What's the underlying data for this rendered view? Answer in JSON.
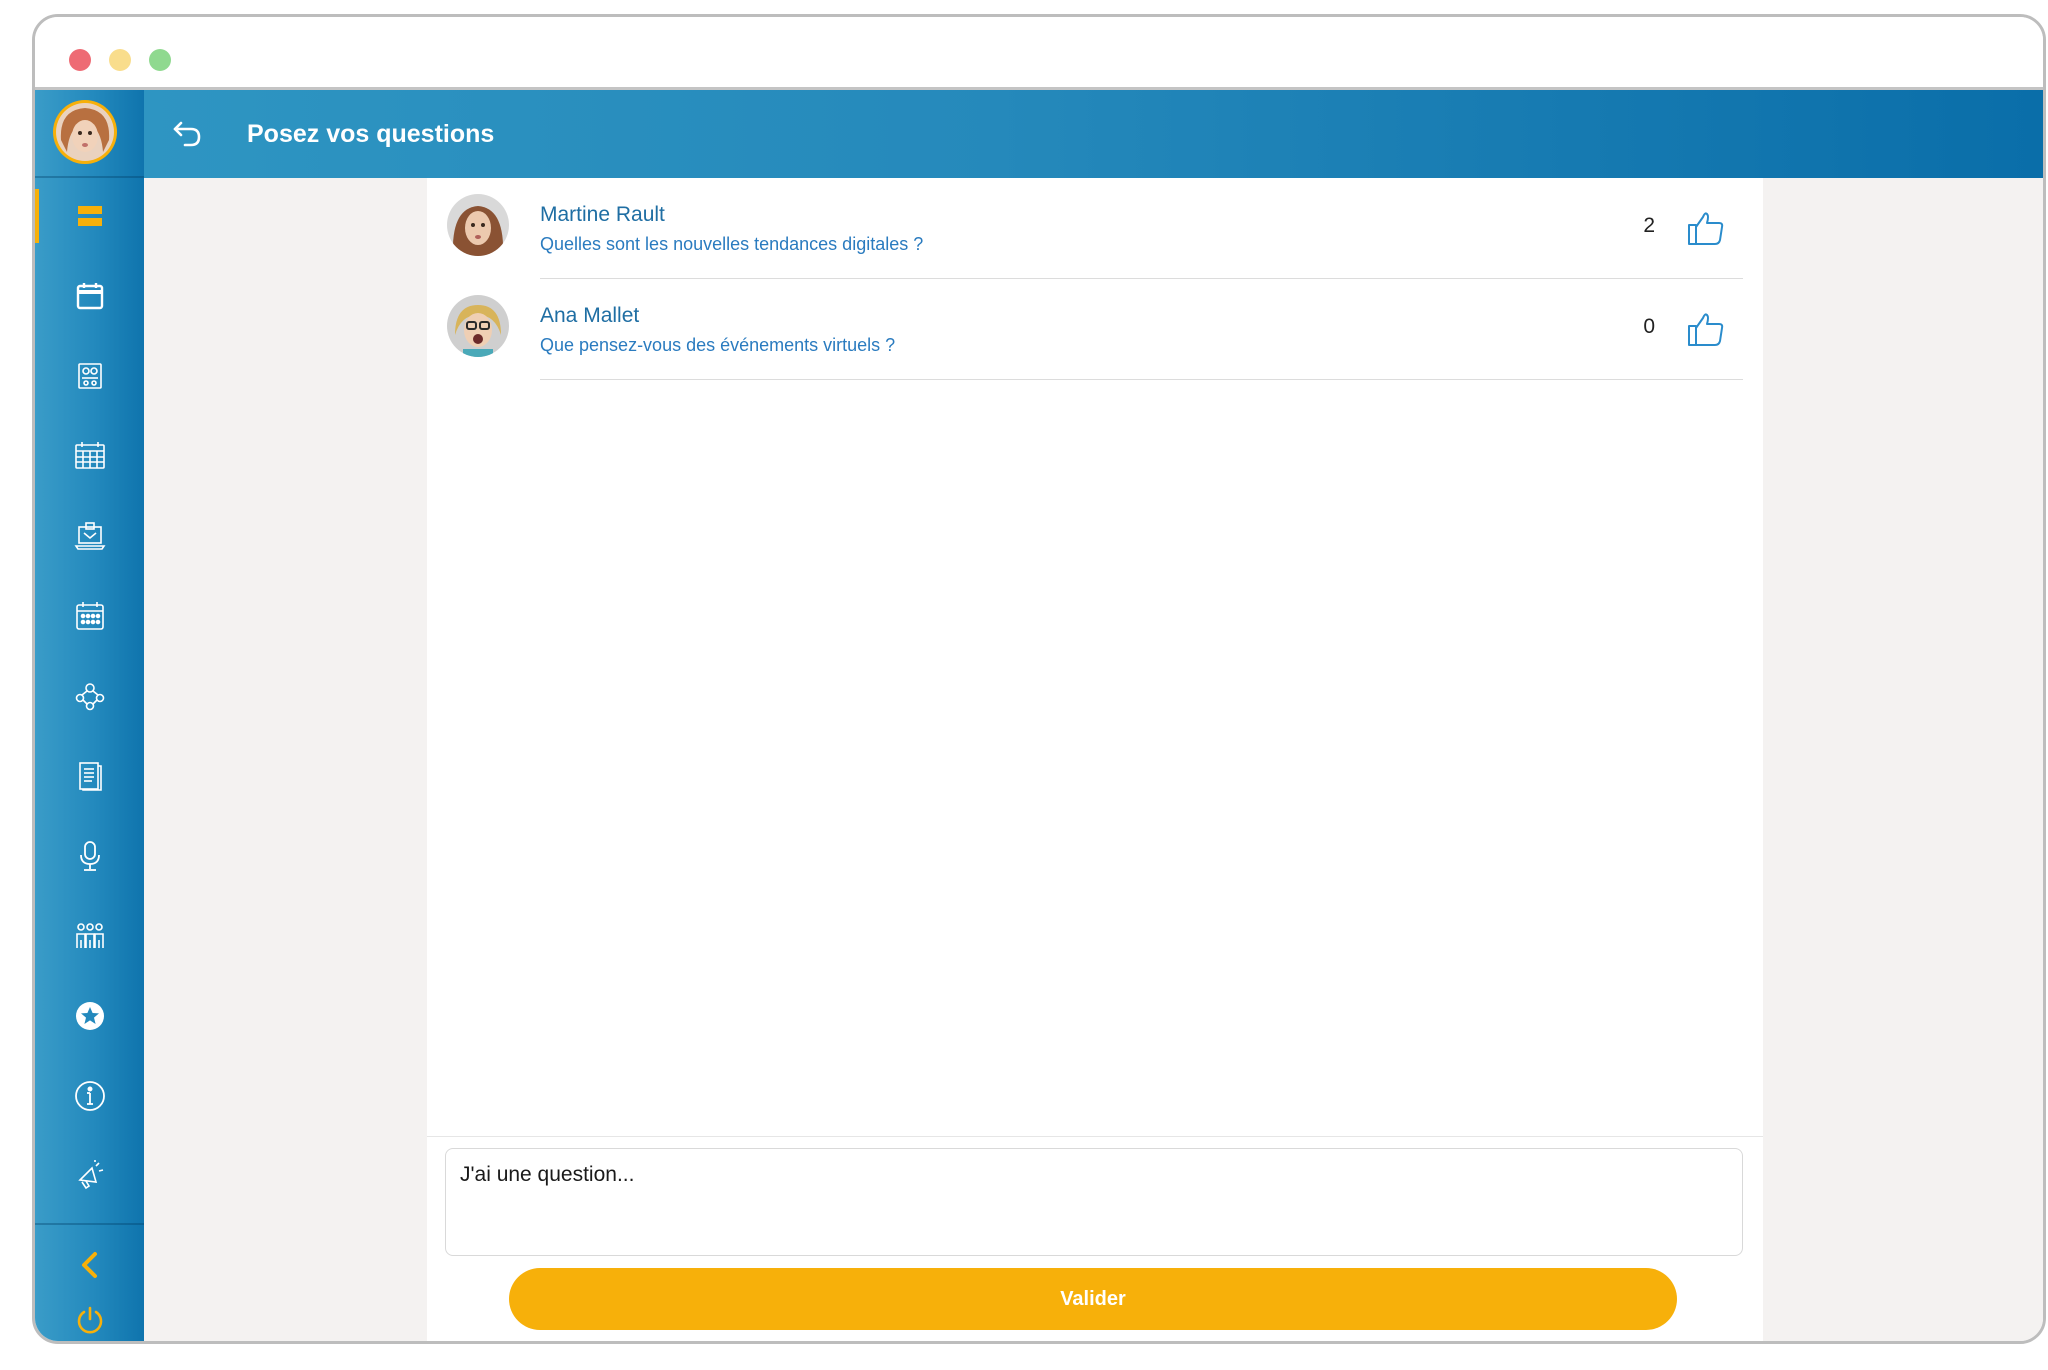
{
  "colors": {
    "accent": "#f7b00a",
    "header_start": "#2e95c2",
    "header_end": "#0a6ea9",
    "link_blue": "#1f6ea3",
    "panel_bg": "#f4f2f1"
  },
  "window": {
    "traffic_lights": [
      "#ee6b74",
      "#f9dd8c",
      "#8fd98f"
    ]
  },
  "header": {
    "back_icon": "back-arrow-icon",
    "title": "Posez vos questions"
  },
  "sidebar": {
    "items": [
      {
        "icon": "menu-bars-icon",
        "active": true
      },
      {
        "icon": "calendar-icon",
        "active": false
      },
      {
        "icon": "map-location-icon",
        "active": false
      },
      {
        "icon": "agenda-grid-icon",
        "active": false
      },
      {
        "icon": "laptop-inbox-icon",
        "active": false
      },
      {
        "icon": "schedule-calendar-icon",
        "active": false
      },
      {
        "icon": "network-people-icon",
        "active": false
      },
      {
        "icon": "document-icon",
        "active": false
      },
      {
        "icon": "microphone-icon",
        "active": false
      },
      {
        "icon": "team-icon",
        "active": false
      },
      {
        "icon": "star-circle-icon",
        "active": false
      },
      {
        "icon": "info-icon",
        "active": false
      },
      {
        "icon": "megaphone-icon",
        "active": false
      }
    ],
    "collapse_icon": "chevron-left-icon",
    "power_icon": "power-icon"
  },
  "questions": [
    {
      "author": "Martine Rault",
      "text": "Quelles sont les nouvelles tendances digitales ?",
      "likes": "2"
    },
    {
      "author": "Ana Mallet",
      "text": "Que pensez-vous des événements virtuels ?",
      "likes": "0"
    }
  ],
  "composer": {
    "placeholder": "J'ai une question...",
    "submit_label": "Valider"
  }
}
